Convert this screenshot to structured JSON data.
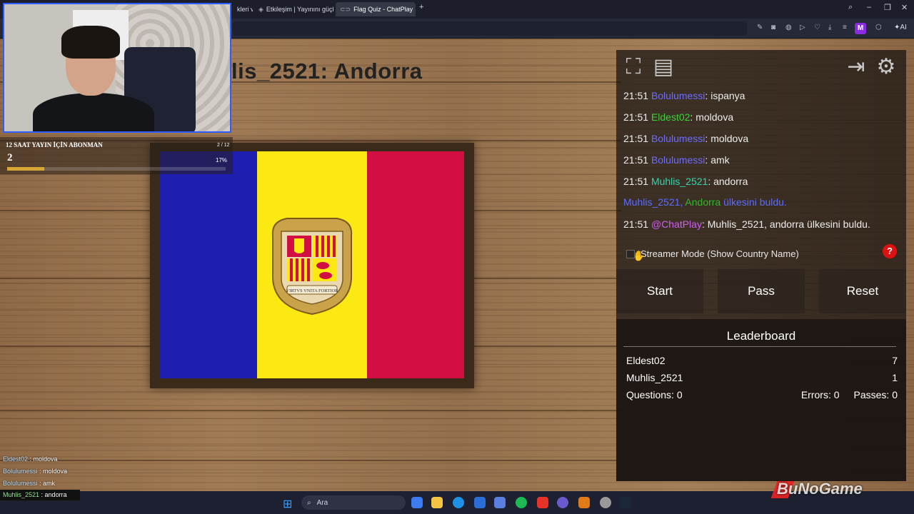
{
  "browser": {
    "tabs": [
      {
        "label": "kleri ve",
        "icon": "tab-icon"
      },
      {
        "label": "Etkileşim | Yayınını güçlen",
        "icon": "diamond-icon"
      },
      {
        "label": "Flag Quiz - ChatPlay",
        "icon": "chatplay-icon",
        "active": true
      }
    ],
    "new_tab": "+",
    "profile_initial": "M",
    "ai_label": "AI"
  },
  "quiz": {
    "title": "lis_2521: Andorra",
    "flag_country": "Andorra",
    "motto": "VIRTVS VNITA FORTIOR",
    "colors": {
      "blue": "#1e1fb1",
      "yellow": "#fce813",
      "red": "#d20f43"
    }
  },
  "chat": {
    "messages": [
      {
        "time": "21:51",
        "user": "Bolulumessi",
        "sep": ": ",
        "text": "ispanya"
      },
      {
        "time": "21:51",
        "user": "Eldest02",
        "sep": ": ",
        "text": "moldova"
      },
      {
        "time": "21:51",
        "user": "Bolulumessi",
        "sep": ": ",
        "text": "moldova"
      },
      {
        "time": "21:51",
        "user": "Bolulumessi",
        "sep": ": ",
        "text": "amk"
      },
      {
        "time": "21:51",
        "user": "Muhlis_2521",
        "sep": ": ",
        "text": "andorra"
      },
      {
        "time": "",
        "user": "Muhlis_2521, ",
        "sep": "Andorra",
        "text": " ülkesini buldu."
      },
      {
        "time": "21:51",
        "user": "@ChatPlay",
        "sep": ": ",
        "text": "Muhlis_2521, andorra ülkesini buldu."
      }
    ]
  },
  "controls": {
    "streamer_mode_label": "Streamer Mode (Show Country Name)",
    "help_label": "?",
    "start_label": "Start",
    "pass_label": "Pass",
    "reset_label": "Reset"
  },
  "leaderboard": {
    "title": "Leaderboard",
    "rows": [
      {
        "name": "Eldest02",
        "score": "7"
      },
      {
        "name": "Muhlis_2521",
        "score": "1"
      }
    ],
    "questions_label": "Questions: 0",
    "errors_label": "Errors: 0",
    "passes_label": "Passes: 0"
  },
  "overlay": {
    "sub_goal_title": "12 SAAT YAYIN İÇİN ABONMAN",
    "sub_goal_value": "2",
    "sub_goal_count": "2 / 12",
    "sub_goal_percent": "17%",
    "sub_goal_progress": 0.17,
    "stream_chat": [
      {
        "user": "Eldest02",
        "text": " : moldova"
      },
      {
        "user": "Bolulumessi",
        "text": " : moldova"
      },
      {
        "user": "Bolulumessi",
        "text": " : amk"
      },
      {
        "user": "Muhlis_2521",
        "text": " : andorra"
      }
    ],
    "brand": "BuNoGame"
  },
  "taskbar": {
    "search_placeholder": "Ara"
  }
}
